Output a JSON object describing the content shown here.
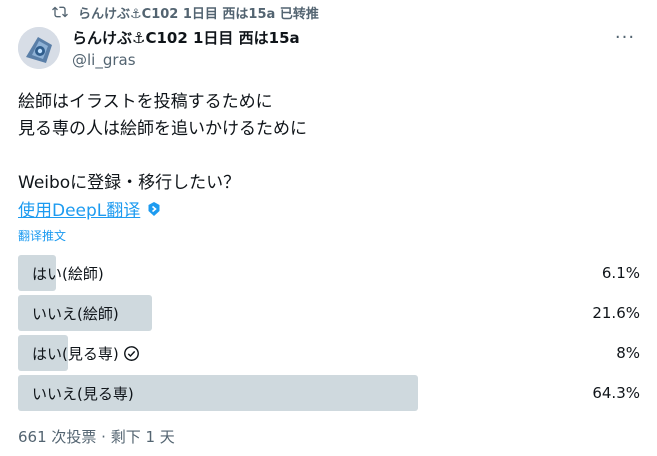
{
  "repost": {
    "text": "らんけぶ⚓C102 1日目 西は15a 已转推",
    "icon": "repost-icon"
  },
  "author": {
    "display_name": "らんけぶ⚓C102 1日目 西は15a",
    "handle": "@li_gras"
  },
  "more_label": "···",
  "tweet": {
    "text": "絵師はイラストを投稿するために\n見る専の人は絵師を追いかけるために\n\nWeiboに登録・移行したい？"
  },
  "translate": {
    "label": "使用DeepL翻译",
    "icon": "deepl-badge-icon",
    "tweet_label": "翻译推文"
  },
  "poll": {
    "options": [
      {
        "label": "はい(絵師)",
        "percent_text": "6.1%",
        "fraction": 0.061,
        "selected": false
      },
      {
        "label": "いいえ(絵師)",
        "percent_text": "21.6%",
        "fraction": 0.216,
        "selected": false
      },
      {
        "label": "はい(見る専)",
        "percent_text": "8%",
        "fraction": 0.08,
        "selected": true
      },
      {
        "label": "いいえ(見る専)",
        "percent_text": "64.3%",
        "fraction": 0.643,
        "selected": false
      }
    ],
    "footer": "661 次投票 · 剩下 1 天"
  },
  "colors": {
    "accent": "#1d9bf0",
    "bar": "#cfd9de",
    "muted": "#536471"
  }
}
